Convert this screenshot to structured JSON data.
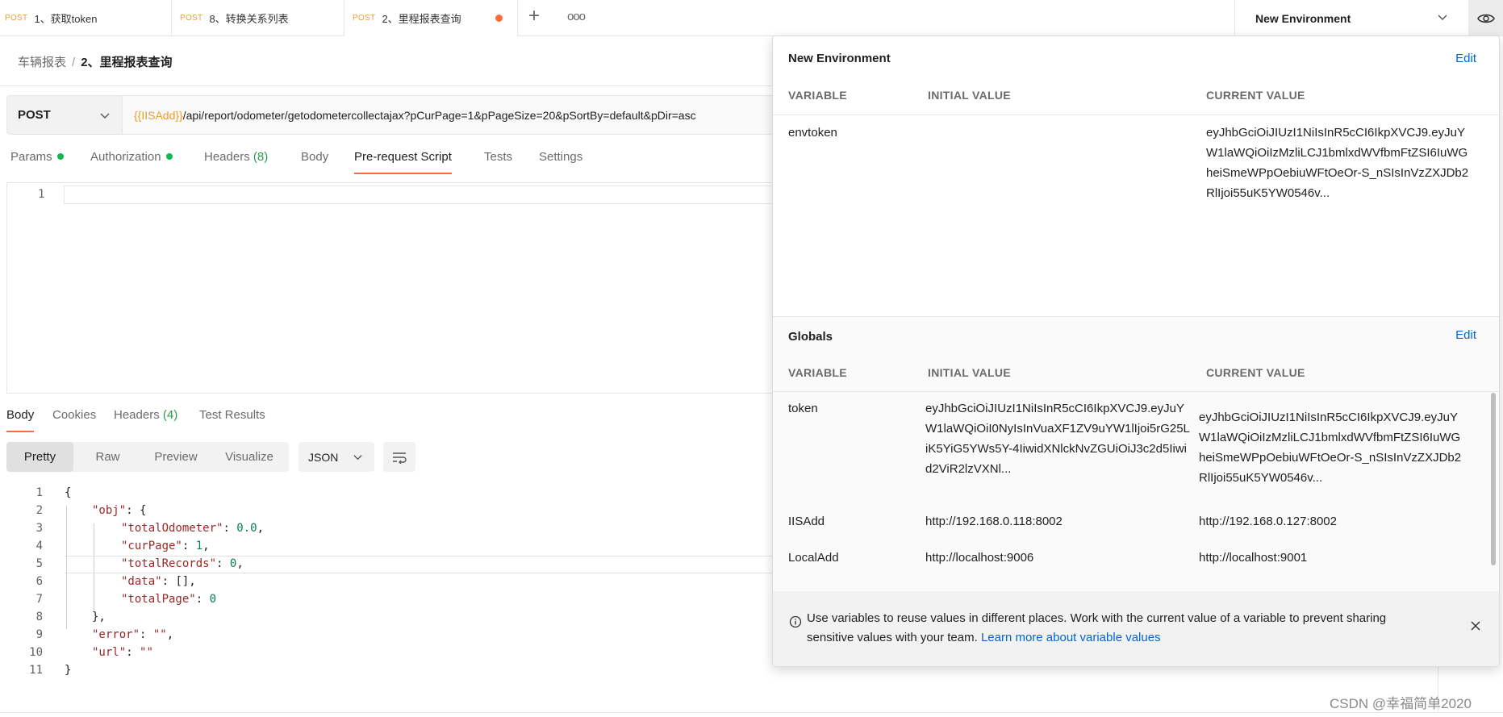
{
  "tabs": [
    {
      "method": "POST",
      "label": "1、获取token"
    },
    {
      "method": "POST",
      "label": "8、转换关系列表"
    },
    {
      "method": "POST",
      "label": "2、里程报表查询"
    }
  ],
  "environment": {
    "selected": "New Environment"
  },
  "breadcrumb": {
    "collection": "车辆报表",
    "separator": "/",
    "current": "2、里程报表查询"
  },
  "request": {
    "method": "POST",
    "url_var": "{{IISAdd}}",
    "url_rest": "/api/report/odometer/getodometercollectajax?pCurPage=1&pPageSize=20&pSortBy=default&pDir=asc"
  },
  "request_tabs": [
    {
      "label": "Params",
      "count": "",
      "dot": true
    },
    {
      "label": "Authorization",
      "count": "",
      "dot": true
    },
    {
      "label": "Headers",
      "count": "(8)",
      "dot": false
    },
    {
      "label": "Body",
      "count": "",
      "dot": false
    },
    {
      "label": "Pre-request Script",
      "count": "",
      "dot": false,
      "active": true
    },
    {
      "label": "Tests",
      "count": "",
      "dot": false
    },
    {
      "label": "Settings",
      "count": "",
      "dot": false
    }
  ],
  "editor": {
    "line_number": "1"
  },
  "response_tabs": [
    {
      "label": "Body",
      "count": "",
      "active": true
    },
    {
      "label": "Cookies",
      "count": ""
    },
    {
      "label": "Headers",
      "count": "(4)"
    },
    {
      "label": "Test Results",
      "count": ""
    }
  ],
  "view_modes": [
    "Pretty",
    "Raw",
    "Preview",
    "Visualize"
  ],
  "format": "JSON",
  "response_lines": [
    {
      "n": "1"
    },
    {
      "n": "2"
    },
    {
      "n": "3"
    },
    {
      "n": "4"
    },
    {
      "n": "5"
    },
    {
      "n": "6"
    },
    {
      "n": "7"
    },
    {
      "n": "8"
    },
    {
      "n": "9"
    },
    {
      "n": "10"
    },
    {
      "n": "11"
    }
  ],
  "response": {
    "l1": "{",
    "obj_key": "\"obj\"",
    "obj_open": "{",
    "totalOdometer_key": "\"totalOdometer\"",
    "totalOdometer_val": "0.0",
    "curPage_key": "\"curPage\"",
    "curPage_val": "1",
    "totalRecords_key": "\"totalRecords\"",
    "totalRecords_val": "0",
    "data_key": "\"data\"",
    "data_val": "[]",
    "totalPage_key": "\"totalPage\"",
    "totalPage_val": "0",
    "obj_close": "},",
    "error_key": "\"error\"",
    "error_val": "\"\"",
    "url_key": "\"url\"",
    "url_val": "\"\"",
    "l11": "}"
  },
  "popover": {
    "env": {
      "title": "New Environment",
      "edit": "Edit",
      "headers": [
        "VARIABLE",
        "INITIAL VALUE",
        "CURRENT VALUE"
      ],
      "rows": [
        {
          "variable": "envtoken",
          "initial": "",
          "current": "eyJhbGciOiJIUzI1NiIsInR5cCI6IkpXVCJ9.eyJuYW1laWQiOiIzMzliLCJ1bmlxdWVfbmFtZSI6IuWGheiSmeWPpOebiuWFtOeOr-S_nSIsInVzZXJDb2RlIjoi55uK5YW0546v..."
        }
      ]
    },
    "globals": {
      "title": "Globals",
      "edit": "Edit",
      "headers": [
        "VARIABLE",
        "INITIAL VALUE",
        "CURRENT VALUE"
      ],
      "rows": [
        {
          "variable": "token",
          "initial": "eyJhbGciOiJIUzI1NiIsInR5cCI6IkpXVCJ9.eyJuYW1laWQiOiI0NyIsInVuaXF1ZV9uYW1lIjoi5rG25LiK5YiG5YWs5Y-4IiwidXNlckNvZGUiOiJ3c2d5Iiwid2ViR2lzVXNl...",
          "current": "eyJhbGciOiJIUzI1NiIsInR5cCI6IkpXVCJ9.eyJuYW1laWQiOiIzMzliLCJ1bmlxdWVfbmFtZSI6IuWGheiSmeWPpOebiuWFtOeOr-S_nSIsInVzZXJDb2RlIjoi55uK5YW0546v..."
        },
        {
          "variable": "IISAdd",
          "initial": "http://192.168.0.118:8002",
          "current": "http://192.168.0.127:8002"
        },
        {
          "variable": "LocalAdd",
          "initial": "http://localhost:9006",
          "current": "http://localhost:9001"
        }
      ]
    },
    "info": {
      "text": "Use variables to reuse values in different places. Work with the current value of a variable to prevent sharing sensitive values with your team.",
      "link": "Learn more about variable values"
    }
  },
  "watermark": "CSDN @幸福简单2020",
  "colors": {
    "accent": "#ff6c37",
    "method_post": "#e8a02e",
    "link": "#0265d2",
    "status_dot": "#0cbb52"
  },
  "icons": {
    "chevron": "chevron-down-icon",
    "eye": "eye-icon",
    "plus": "plus-icon",
    "more": "more-icon",
    "wrap": "wrap-lines-icon",
    "info": "info-icon",
    "close": "close-icon"
  }
}
